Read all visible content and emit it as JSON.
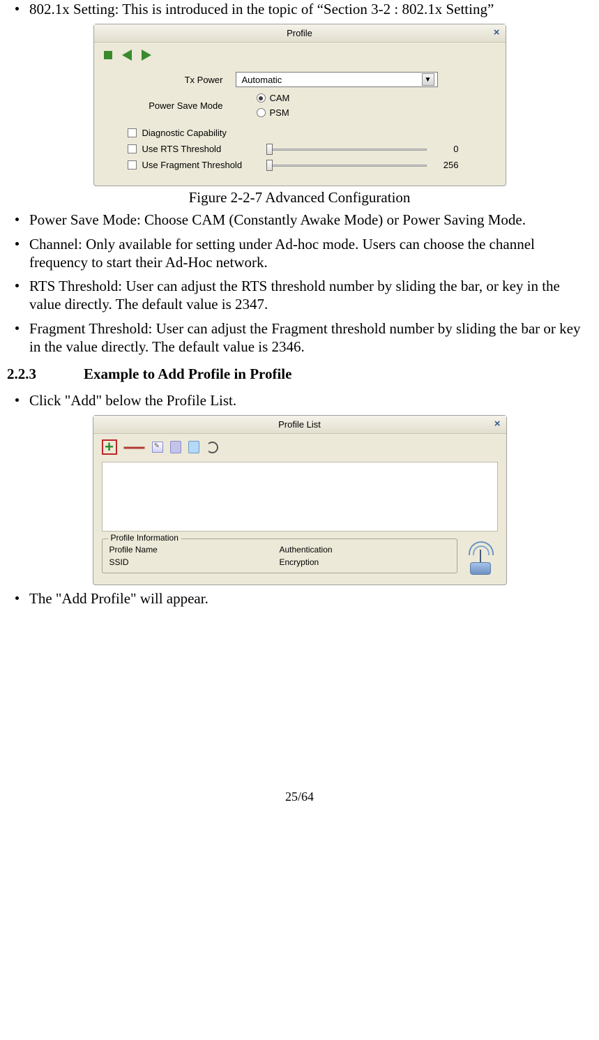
{
  "bullets_top": [
    "802.1x Setting: This is introduced in the topic of “Section 3-2 : 802.1x Setting”"
  ],
  "figure1": {
    "title": "Profile",
    "tx_power_label": "Tx Power",
    "tx_power_value": "Automatic",
    "psm_label": "Power Save Mode",
    "psm_opt1": "CAM",
    "psm_opt2": "PSM",
    "chk_diag": "Diagnostic Capability",
    "chk_rts": "Use RTS Threshold",
    "chk_frag": "Use Fragment Threshold",
    "rts_value": "0",
    "frag_value": "256",
    "caption": "Figure 2-2-7 Advanced Configuration"
  },
  "bullets_mid": [
    "Power Save Mode: Choose CAM (Constantly Awake Mode) or Power Saving Mode.",
    "Channel: Only available for setting under Ad-hoc mode. Users can choose the channel frequency to start their Ad-Hoc network.",
    "RTS Threshold: User can adjust the RTS threshold number by sliding the bar, or key in the value directly. The default value is 2347.",
    "Fragment Threshold: User can adjust the Fragment threshold number by sliding the bar or key in the value directly. The default value is 2346."
  ],
  "section": {
    "num": "2.2.3",
    "title": "Example to Add Profile in Profile"
  },
  "bullets_steps_1": [
    "Click \"Add\" below the Profile List."
  ],
  "figure2": {
    "title": "Profile List",
    "legend": "Profile Information",
    "pn_label": "Profile Name",
    "ssid_label": "SSID",
    "auth_label": "Authentication",
    "enc_label": "Encryption"
  },
  "bullets_steps_2": [
    "The \"Add Profile\" will appear."
  ],
  "page_number": "25/64"
}
